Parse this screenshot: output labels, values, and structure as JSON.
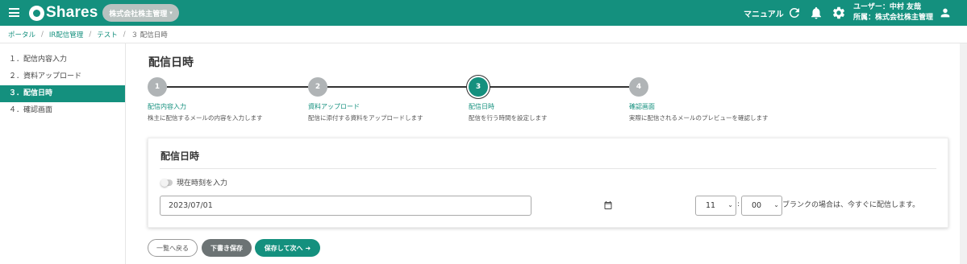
{
  "header": {
    "logo_text": "Shares",
    "org_selector": "株式会社株主管理",
    "manual_label": "マニュアル",
    "user_line": "ユーザー：中村 友哉",
    "affiliation_line": "所属：株式会社株主管理",
    "bg_color": "#14907e"
  },
  "breadcrumb": [
    "ポータル",
    "IR配信管理",
    "テスト",
    "３ 配信日時"
  ],
  "sidebar": {
    "items": [
      {
        "label": "１．配信内容入力",
        "active": false
      },
      {
        "label": "２．資料アップロード",
        "active": false
      },
      {
        "label": "３．配信日時",
        "active": true
      },
      {
        "label": "４．確認画面",
        "active": false
      }
    ]
  },
  "page_title": "配信日時",
  "steps": [
    {
      "number": "1",
      "label": "配信内容入力",
      "desc": "株主に配信するメールの内容を入力します",
      "active": false
    },
    {
      "number": "2",
      "label": "資料アップロード",
      "desc": "配信に添付する資料をアップロードします",
      "active": false
    },
    {
      "number": "3",
      "label": "配信日時",
      "desc": "配信を行う時間を設定します",
      "active": true
    },
    {
      "number": "4",
      "label": "確認画面",
      "desc": "実際に配信されるメールのプレビューを確認します",
      "active": false
    }
  ],
  "form": {
    "card_title": "配信日時",
    "now_toggle_label": "現在時刻を入力",
    "now_toggle_on": false,
    "date_value": "2023/07/01",
    "hour_value": "11",
    "minute_value": "00",
    "time_separator": ":",
    "blank_hint": "ブランクの場合は、今すぐに配信します。"
  },
  "buttons": {
    "back": "一覧へ戻る",
    "draft": "下書き保存",
    "next": "保存して次へ"
  }
}
